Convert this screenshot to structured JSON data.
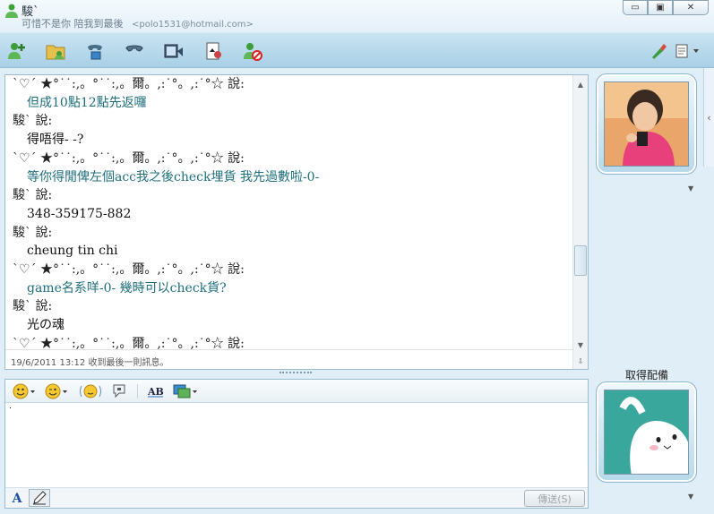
{
  "window": {
    "contact_name": "駿`",
    "contact_status_message": "可惜不是你 陪我到最後",
    "contact_email": "<polo1531@hotmail.com>",
    "controls": {
      "minimize": "▭",
      "maximize": "▣",
      "close": "✕"
    }
  },
  "toolbar": {
    "icons": [
      "invite-contact-icon",
      "share-files-icon",
      "video-call-icon",
      "voice-call-icon",
      "activities-icon",
      "games-icon",
      "block-contact-icon",
      "paint-background-icon",
      "menu-icon"
    ]
  },
  "chat": {
    "messages": [
      {
        "kind": "sender",
        "text": "ˋ♡ˊ           ★°˙˙:,。°˙˙:,。爾。,:˙°。,:˙°☆ 說:"
      },
      {
        "kind": "own",
        "text": "但成10點12點先返囉"
      },
      {
        "kind": "sender",
        "text": "駿` 說:"
      },
      {
        "kind": "other",
        "text": "得唔得- -?"
      },
      {
        "kind": "sender",
        "text": "ˋ♡ˊ           ★°˙˙:,。°˙˙:,。爾。,:˙°。,:˙°☆ 說:"
      },
      {
        "kind": "own",
        "text": "等你得閒俾左個acc我之後check埋貨 我先過數啦-0-"
      },
      {
        "kind": "sender",
        "text": "駿` 說:"
      },
      {
        "kind": "other",
        "text": "348-359175-882"
      },
      {
        "kind": "sender",
        "text": "駿` 說:"
      },
      {
        "kind": "other",
        "text": "cheung tin chi"
      },
      {
        "kind": "sender",
        "text": "ˋ♡ˊ           ★°˙˙:,。°˙˙:,。爾。,:˙°。,:˙°☆ 說:"
      },
      {
        "kind": "own",
        "text": "game名系咩-0- 幾時可以check貨?"
      },
      {
        "kind": "sender",
        "text": "駿` 說:"
      },
      {
        "kind": "other",
        "text": "光の魂"
      },
      {
        "kind": "sender",
        "text": "ˋ♡ˊ           ★°˙˙:,。°˙˙:,。爾。,:˙°。,:˙°☆ 說:"
      }
    ],
    "status_line": "19/6/2011 13:12 收到最後一則訊息。"
  },
  "compose": {
    "toolbar_icons": [
      "emoticon-icon",
      "wink-icon",
      "nudge-icon",
      "voice-clip-icon",
      "font-style-icon",
      "background-icon"
    ],
    "input_value": "",
    "font_button": "A",
    "send_label": "傳送(S)"
  },
  "sidebar": {
    "get_decoration_label": "取得配備",
    "expand_arrow": "‹"
  }
}
